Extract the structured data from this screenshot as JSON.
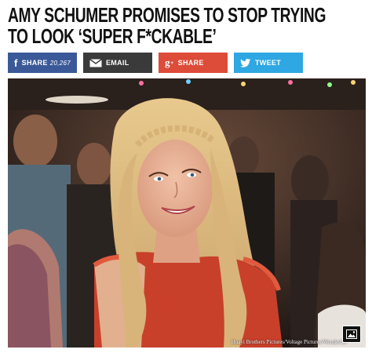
{
  "article": {
    "headline_line1": "AMY SCHUMER PROMISES TO STOP TRYING",
    "headline_line2": "TO LOOK ‘SUPER F*CKABLE’"
  },
  "share": {
    "facebook": {
      "label": "SHARE",
      "count": "20,267",
      "icon": "facebook-icon"
    },
    "email": {
      "label": "EMAIL",
      "icon": "mail-icon"
    },
    "googleplus": {
      "label": "SHARE",
      "icon": "google-plus-icon"
    },
    "twitter": {
      "label": "TWEET",
      "icon": "twitter-icon"
    }
  },
  "photo": {
    "credit": "Huayi Brothers Pictures/Voltage Pictures/Wonderlan",
    "gallery_icon": "image-gallery-icon"
  },
  "colors": {
    "facebook": "#3b5998",
    "email": "#3a3a3a",
    "googleplus": "#dd4b39",
    "twitter": "#2fa7e2"
  }
}
